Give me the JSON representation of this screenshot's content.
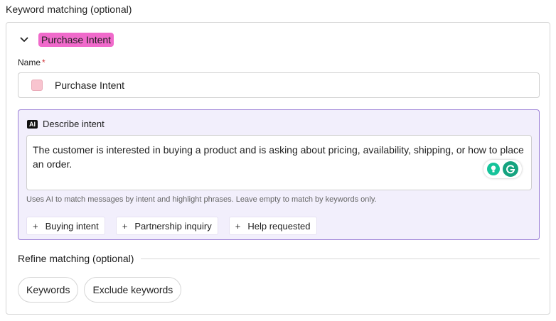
{
  "section": {
    "title": "Keyword matching (optional)"
  },
  "group": {
    "tag_label": "Purchase Intent",
    "tag_color": "#f06acb"
  },
  "name_field": {
    "label": "Name",
    "required_mark": "*",
    "value": "Purchase Intent",
    "swatch_color": "#f8c4cf"
  },
  "ai": {
    "badge": "AI",
    "label": "Describe intent",
    "text": "The customer is interested in buying a product and is asking about pricing, availability, shipping, or how to place an order.",
    "hint": "Uses AI to match messages by intent and highlight phrases. Leave empty to match by keywords only.",
    "suggestions": [
      {
        "label": "Buying intent"
      },
      {
        "label": "Partnership inquiry"
      },
      {
        "label": "Help requested"
      }
    ],
    "accent_color": "#9b7fd6"
  },
  "refine": {
    "title": "Refine matching (optional)",
    "buttons": [
      {
        "label": "Keywords"
      },
      {
        "label": "Exclude keywords"
      }
    ]
  },
  "icons": {
    "chevron": "chevron-down-icon",
    "plus": "plus-icon",
    "grammarly": "grammarly-icon",
    "bulb": "lightbulb-icon"
  }
}
